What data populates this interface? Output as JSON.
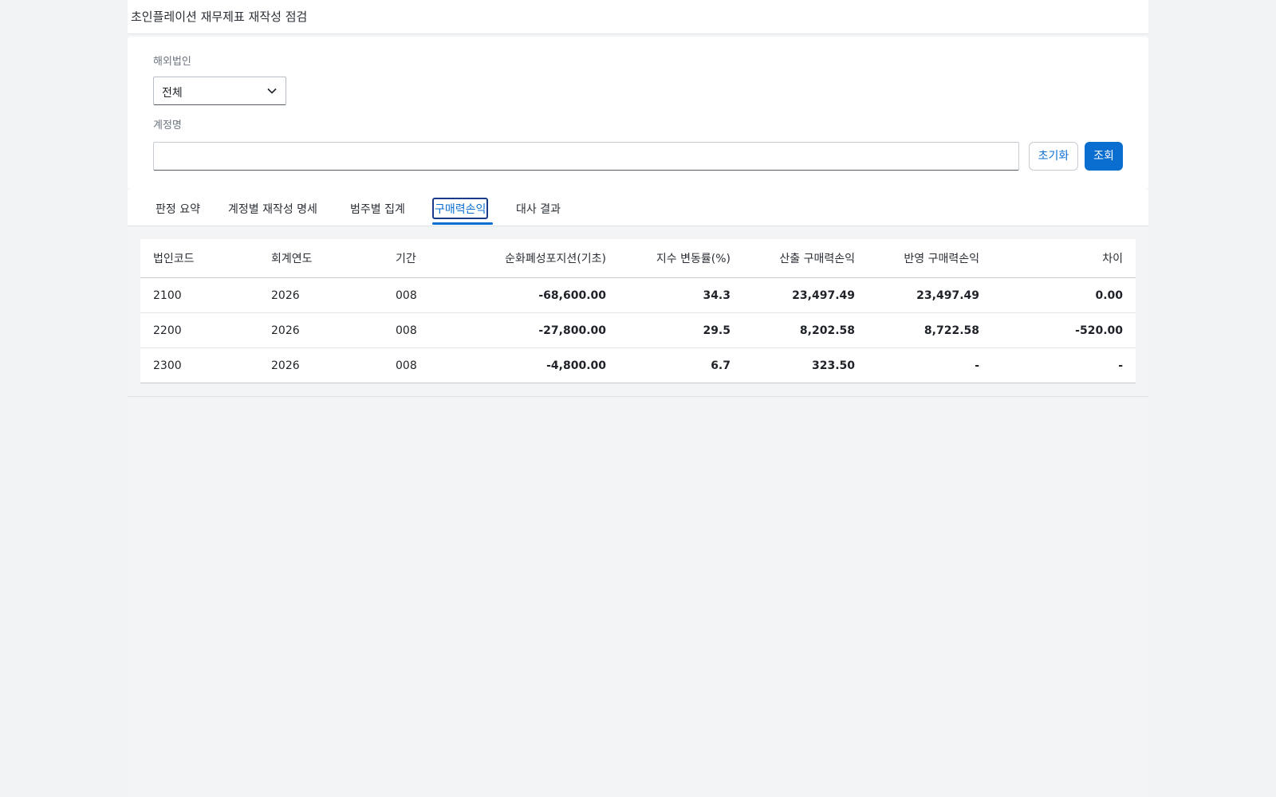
{
  "app": {
    "title": "초인플레이션 재무제표 재작성 점검"
  },
  "filters": {
    "entity_label": "해외법인",
    "entity_value": "전체",
    "account_label": "계정명",
    "account_value": "",
    "reset_label": "초기화",
    "search_label": "조회"
  },
  "tabs": [
    {
      "label": "판정 요약",
      "active": false
    },
    {
      "label": "계정별 재작성 명세",
      "active": false
    },
    {
      "label": "범주별 집계",
      "active": false
    },
    {
      "label": "구매력손익",
      "active": true
    },
    {
      "label": "대사 결과",
      "active": false
    }
  ],
  "table": {
    "headers": [
      "법인코드",
      "회계연도",
      "기간",
      "순화폐성포지션(기초)",
      "지수 변동률(%)",
      "산출 구매력손익",
      "반영 구매력손익",
      "차이"
    ],
    "rows": [
      [
        "2100",
        "2026",
        "008",
        "-68,600.00",
        "34.3",
        "23,497.49",
        "23,497.49",
        "0.00"
      ],
      [
        "2200",
        "2026",
        "008",
        "-27,800.00",
        "29.5",
        "8,202.58",
        "8,722.58",
        "-520.00"
      ],
      [
        "2300",
        "2026",
        "008",
        "-4,800.00",
        "6.7",
        "323.50",
        "-",
        "-"
      ]
    ]
  },
  "colors": {
    "accent": "#0a6ed1",
    "focus_ring": "#1a3a8a"
  }
}
